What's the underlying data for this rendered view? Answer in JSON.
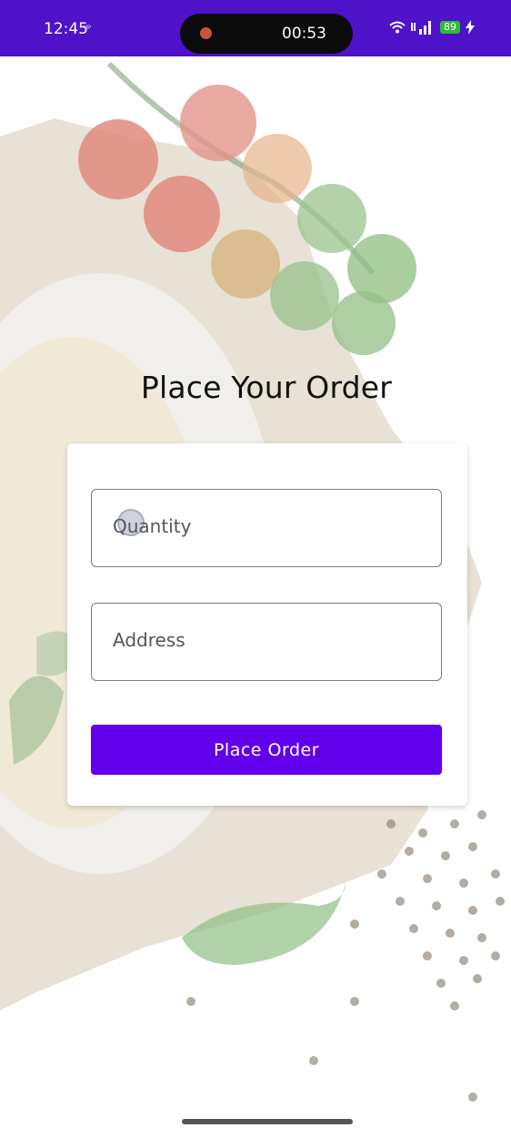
{
  "status_bar": {
    "time": "12:45",
    "indicator": "ᵘᵖ",
    "recording_timer": "00:53",
    "battery_level": "89",
    "icons": [
      "wifi-icon",
      "signal-icon",
      "battery-icon",
      "charging-bolt-icon"
    ]
  },
  "page": {
    "title": "Place Your Order"
  },
  "form": {
    "quantity_placeholder": "Quantity",
    "address_placeholder": "Address",
    "submit_label": "Place Order"
  },
  "colors": {
    "status_bar": "#4e12c9",
    "accent": "#6200ee",
    "battery": "#2bbd3a"
  }
}
